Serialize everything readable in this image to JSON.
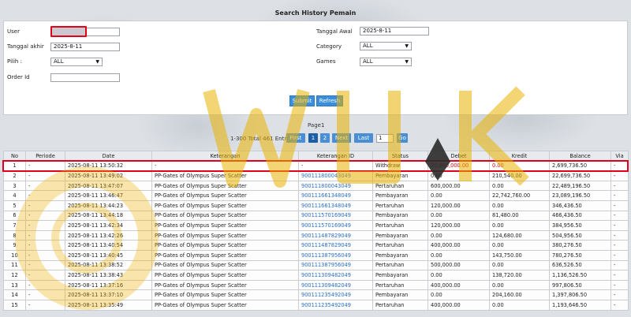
{
  "page": {
    "title": "Search History Pemain"
  },
  "form": {
    "user_label": "User",
    "user_value": "",
    "tanggal_awal_label": "Tanggal Awal",
    "tanggal_awal_value": "2025-8-11",
    "tanggal_akhir_label": "Tanggal akhir",
    "tanggal_akhir_value": "2025-8-11",
    "category_label": "Category",
    "category_value": "ALL",
    "pilih_label": "Pilih :",
    "pilih_value": "ALL",
    "games_label": "Games",
    "games_value": "ALL",
    "order_label": "Order Id",
    "order_value": "",
    "submit_label": "Submit",
    "refresh_label": "Refresh"
  },
  "pager": {
    "page_label": "Page1",
    "info": "1-300 Total 461 Entri",
    "first": "First",
    "p1": "1",
    "p2": "2",
    "next": "Next",
    "last": "Last",
    "input_value": "1",
    "go": "Go"
  },
  "table": {
    "headers": [
      "No",
      "Periode",
      "Date",
      "Keterangan",
      "Keterangan ID",
      "Status",
      "Debet",
      "Kredit",
      "Balance",
      "Via"
    ],
    "rows": [
      [
        "1",
        "-",
        "2025-08-11 13:50:32",
        "-",
        "-",
        "Withdraw",
        "20,000,000.00",
        "0.00",
        "2,699,736.50",
        "-"
      ],
      [
        "2",
        "-",
        "2025-08-11 13:49:02",
        "PP-Gates of Olympus Super Scatter",
        "900111800043049",
        "Pembayaran",
        "0.00",
        "210,540.00",
        "22,699,736.50",
        "-"
      ],
      [
        "3",
        "-",
        "2025-08-11 13:47:07",
        "PP-Gates of Olympus Super Scatter",
        "900111800043049",
        "Pertaruhan",
        "600,000.00",
        "0.00",
        "22,489,196.50",
        "-"
      ],
      [
        "4",
        "-",
        "2025-08-11 13:46:47",
        "PP-Gates of Olympus Super Scatter",
        "900111661348049",
        "Pembayaran",
        "0.00",
        "22,742,760.00",
        "23,089,196.50",
        "-"
      ],
      [
        "5",
        "-",
        "2025-08-11 13:44:23",
        "PP-Gates of Olympus Super Scatter",
        "900111661348049",
        "Pertaruhan",
        "120,000.00",
        "0.00",
        "346,436.50",
        "-"
      ],
      [
        "6",
        "-",
        "2025-08-11 13:44:18",
        "PP-Gates of Olympus Super Scatter",
        "900111570169049",
        "Pembayaran",
        "0.00",
        "81,480.00",
        "466,436.50",
        "-"
      ],
      [
        "7",
        "-",
        "2025-08-11 13:42:34",
        "PP-Gates of Olympus Super Scatter",
        "900111570169049",
        "Pertaruhan",
        "120,000.00",
        "0.00",
        "384,956.50",
        "-"
      ],
      [
        "8",
        "-",
        "2025-08-11 13:42:26",
        "PP-Gates of Olympus Super Scatter",
        "900111487829049",
        "Pembayaran",
        "0.00",
        "124,680.00",
        "504,956.50",
        "-"
      ],
      [
        "9",
        "-",
        "2025-08-11 13:40:54",
        "PP-Gates of Olympus Super Scatter",
        "900111487829049",
        "Pertaruhan",
        "400,000.00",
        "0.00",
        "380,276.50",
        "-"
      ],
      [
        "10",
        "-",
        "2025-08-11 13:40:45",
        "PP-Gates of Olympus Super Scatter",
        "900111387956049",
        "Pembayaran",
        "0.00",
        "143,750.00",
        "780,276.50",
        "-"
      ],
      [
        "11",
        "-",
        "2025-08-11 13:38:52",
        "PP-Gates of Olympus Super Scatter",
        "900111387956049",
        "Pertaruhan",
        "500,000.00",
        "0.00",
        "636,526.50",
        "-"
      ],
      [
        "12",
        "-",
        "2025-08-11 13:38:43",
        "PP-Gates of Olympus Super Scatter",
        "900111309482049",
        "Pembayaran",
        "0.00",
        "138,720.00",
        "1,136,526.50",
        "-"
      ],
      [
        "13",
        "-",
        "2025-08-11 13:37:16",
        "PP-Gates of Olympus Super Scatter",
        "900111309482049",
        "Pertaruhan",
        "400,000.00",
        "0.00",
        "997,806.50",
        "-"
      ],
      [
        "14",
        "-",
        "2025-08-11 13:37:10",
        "PP-Gates of Olympus Super Scatter",
        "900111235492049",
        "Pembayaran",
        "0.00",
        "204,160.00",
        "1,397,806.50",
        "-"
      ],
      [
        "15",
        "-",
        "2025-08-11 13:35:49",
        "PP-Gates of Olympus Super Scatter",
        "900111235492049",
        "Pertaruhan",
        "400,000.00",
        "0.00",
        "1,193,646.50",
        "-"
      ]
    ]
  },
  "colors": {
    "accent": "#3a8fdc",
    "highlight_border": "#e0001b",
    "link": "#2a6fc1",
    "negative": "#d40000"
  }
}
